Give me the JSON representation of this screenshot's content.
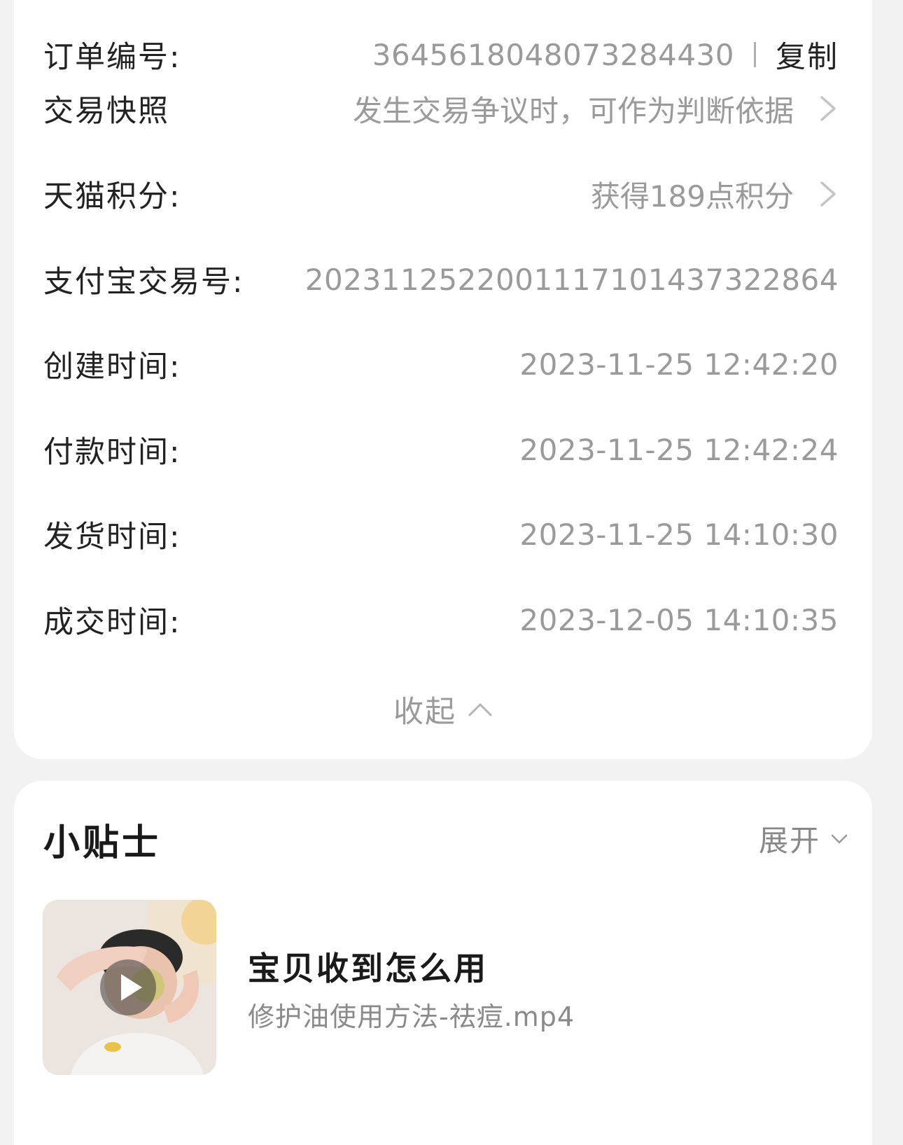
{
  "order_info": {
    "rows": [
      {
        "label": "订单编号:",
        "value": "3645618048073284430",
        "action": "复制"
      },
      {
        "label": "交易快照",
        "value": "发生交易争议时，可作为判断依据"
      },
      {
        "label": "天猫积分:",
        "value": "获得189点积分"
      },
      {
        "label": "支付宝交易号:",
        "value": "2023112522001117101437322864"
      },
      {
        "label": "创建时间:",
        "value": "2023-11-25 12:42:20"
      },
      {
        "label": "付款时间:",
        "value": "2023-11-25 12:42:24"
      },
      {
        "label": "发货时间:",
        "value": "2023-11-25 14:10:30"
      },
      {
        "label": "成交时间:",
        "value": "2023-12-05 14:10:35"
      }
    ],
    "collapse_label": "收起"
  },
  "tips": {
    "title": "小贴士",
    "expand_label": "展开",
    "video": {
      "title": "宝贝收到怎么用",
      "filename": "修护油使用方法-祛痘.mp4",
      "icon": "play-icon"
    }
  },
  "colors": {
    "background": "#f2f2f2",
    "card": "#ffffff",
    "label_text": "#222222",
    "value_text": "#9a9a9a"
  }
}
